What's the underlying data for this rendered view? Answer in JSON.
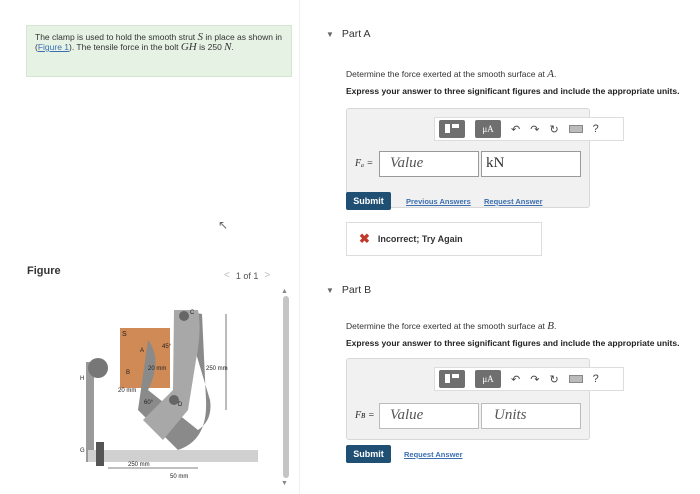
{
  "problem": {
    "text_a": "The clamp is used to hold the smooth strut ",
    "var_s": "S",
    "text_b": " in place as shown in (",
    "figure_link": "Figure 1",
    "text_c": "). The tensile force in the bolt ",
    "var_gh": "GH",
    "text_d": " is 250 ",
    "unit_n": "N",
    "text_e": "."
  },
  "figure": {
    "label": "Figure",
    "pager": "1 of 1",
    "labels": [
      "S",
      "B",
      "A",
      "45°",
      "20 mm",
      "C",
      "250 mm",
      "20 mm",
      "60°",
      "D",
      "H",
      "G",
      "250 mm",
      "50 mm"
    ]
  },
  "partA": {
    "title": "Part A",
    "question_a": "Determine the force exerted at the smooth surface at ",
    "question_var": "A",
    "question_b": ".",
    "instruction": "Express your answer to three significant figures and include the appropriate units.",
    "var_label": "Fₐ =",
    "value_placeholder": "Value",
    "unit_value": "kN",
    "submit": "Submit",
    "prev_answers": "Previous Answers",
    "request_answer": "Request Answer",
    "feedback": "Incorrect; Try Again"
  },
  "partB": {
    "title": "Part B",
    "question_a": "Determine the force exerted at the smooth surface at ",
    "question_var": "B",
    "question_b": ".",
    "instruction": "Express your answer to three significant figures and include the appropriate units.",
    "var_label": "Fʙ =",
    "value_placeholder": "Value",
    "unit_placeholder": "Units",
    "submit": "Submit",
    "request_answer": "Request Answer"
  },
  "toolbar": {
    "mu_label": "μA",
    "help": "?"
  },
  "colors": {
    "problem_bg": "#e6f2e4",
    "submit_bg": "#1f4f73",
    "link": "#3c6fb0",
    "error": "#c0392b",
    "clamp": "#8a8a8a",
    "strut": "#d08a55"
  }
}
